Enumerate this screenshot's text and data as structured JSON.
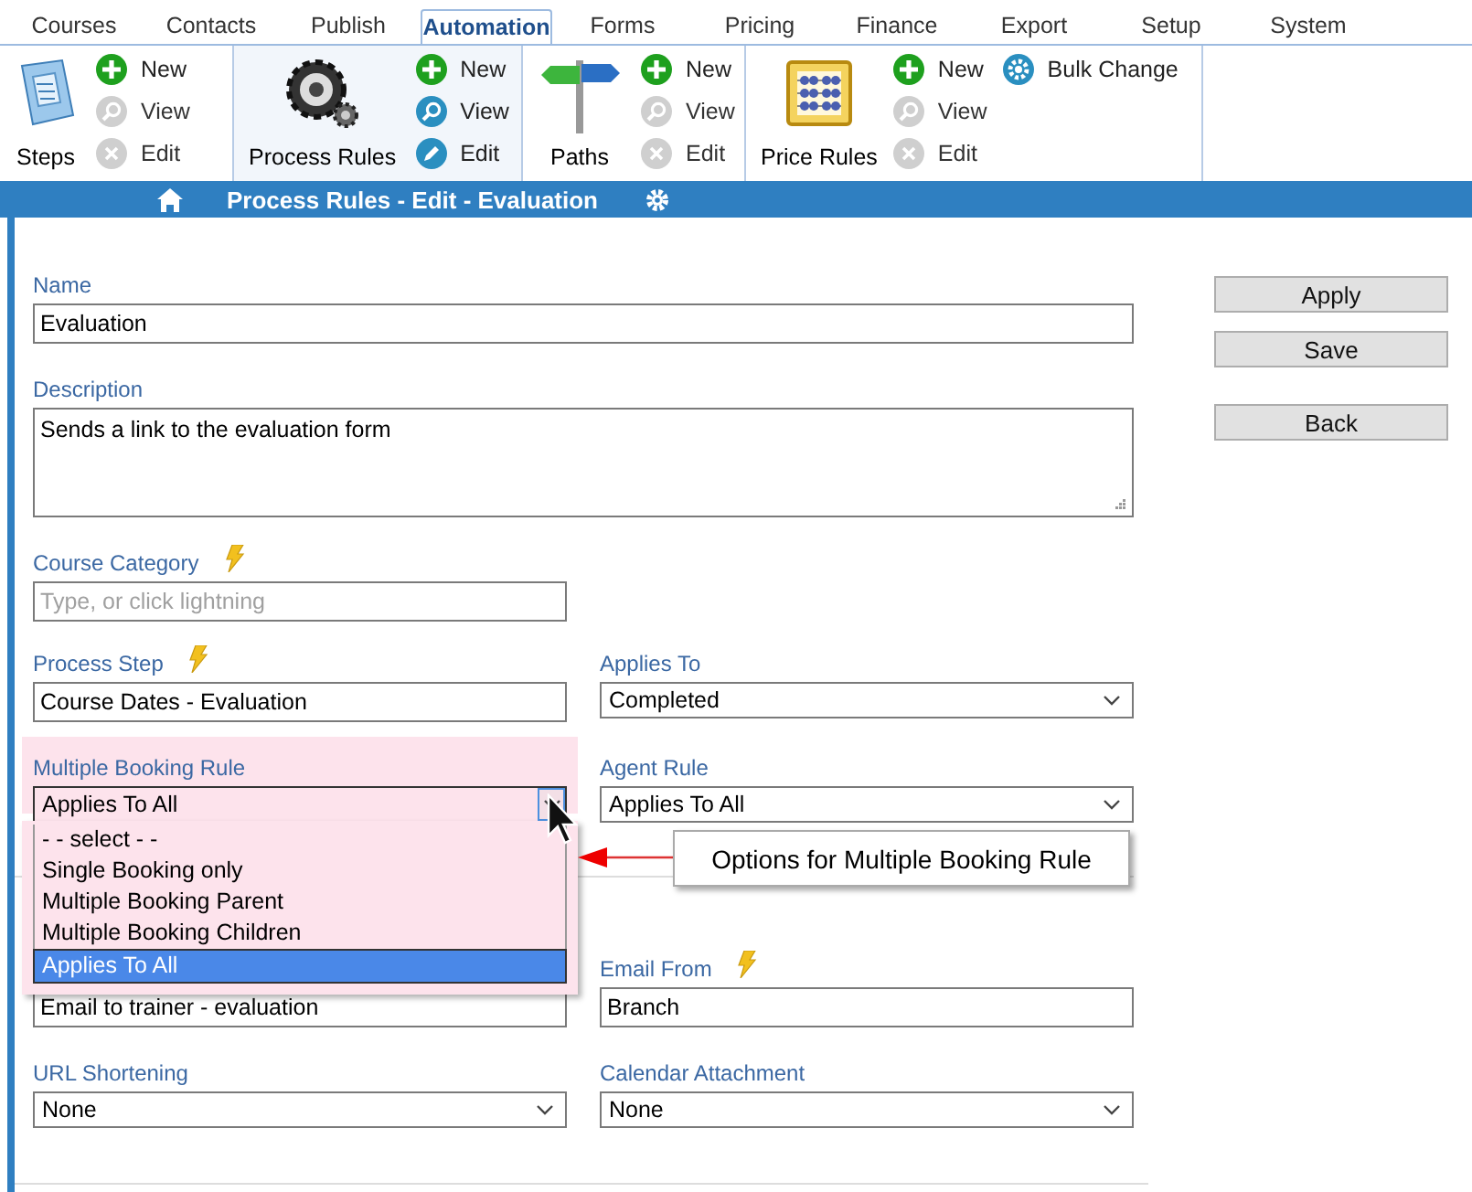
{
  "tabs": [
    {
      "label": "Courses",
      "selected": false
    },
    {
      "label": "Contacts",
      "selected": false
    },
    {
      "label": "Publish",
      "selected": false
    },
    {
      "label": "Automation",
      "selected": true
    },
    {
      "label": "Forms",
      "selected": false
    },
    {
      "label": "Pricing",
      "selected": false
    },
    {
      "label": "Finance",
      "selected": false
    },
    {
      "label": "Export",
      "selected": false
    },
    {
      "label": "Setup",
      "selected": false
    },
    {
      "label": "System",
      "selected": false
    }
  ],
  "ribbon": {
    "groups": [
      {
        "label": "Steps",
        "selected": false,
        "columns": [
          [
            {
              "label": "New",
              "kind": "new",
              "disabled": false
            },
            {
              "label": "View",
              "kind": "view",
              "disabled": true
            },
            {
              "label": "Edit",
              "kind": "edit",
              "disabled": true
            }
          ]
        ]
      },
      {
        "label": "Process Rules",
        "selected": true,
        "columns": [
          [
            {
              "label": "New",
              "kind": "new",
              "disabled": false
            },
            {
              "label": "View",
              "kind": "view",
              "disabled": false
            },
            {
              "label": "Edit",
              "kind": "edit",
              "disabled": false
            }
          ]
        ]
      },
      {
        "label": "Paths",
        "selected": false,
        "columns": [
          [
            {
              "label": "New",
              "kind": "new",
              "disabled": false
            },
            {
              "label": "View",
              "kind": "view",
              "disabled": true
            },
            {
              "label": "Edit",
              "kind": "edit",
              "disabled": true
            }
          ]
        ]
      },
      {
        "label": "Price Rules",
        "selected": false,
        "columns": [
          [
            {
              "label": "New",
              "kind": "new",
              "disabled": false
            },
            {
              "label": "View",
              "kind": "view",
              "disabled": true
            },
            {
              "label": "Edit",
              "kind": "edit",
              "disabled": true
            }
          ],
          [
            {
              "label": "Bulk Change",
              "kind": "bulk",
              "disabled": false
            }
          ]
        ]
      }
    ]
  },
  "title_bar": {
    "title": "Process Rules - Edit - Evaluation"
  },
  "form": {
    "rows": [
      [
        {
          "kind": "text",
          "label": "Name",
          "value": "Evaluation"
        }
      ],
      [
        {
          "kind": "textarea",
          "label": "Description",
          "value": "Sends a link to the evaluation form"
        }
      ],
      [
        {
          "kind": "text",
          "label": "Course Category",
          "placeholder": "Type, or click lightning",
          "lightning": true
        }
      ],
      [
        {
          "kind": "text",
          "label": "Process Step",
          "value": "Course Dates - Evaluation",
          "lightning": true
        },
        {
          "kind": "select",
          "label": "Applies To",
          "value": "Completed"
        }
      ],
      [
        {
          "kind": "select",
          "label": "Multiple Booking Rule",
          "value": "Applies To All",
          "highlighted": true,
          "open": true,
          "options": [
            {
              "label": "- - select - -",
              "selected": false
            },
            {
              "label": "Single Booking only",
              "selected": false
            },
            {
              "label": "Multiple Booking Parent",
              "selected": false
            },
            {
              "label": "Multiple Booking Children",
              "selected": false
            },
            {
              "label": "Applies To All",
              "selected": true
            }
          ]
        },
        {
          "kind": "select",
          "label": "Agent Rule",
          "value": "Applies To All"
        }
      ],
      [
        {
          "kind": "text",
          "value": "Email to trainer - evaluation"
        },
        {
          "kind": "text",
          "label": "Email From",
          "value": "Branch",
          "lightning": true
        }
      ],
      [
        {
          "kind": "select",
          "label": "URL Shortening",
          "value": "None"
        },
        {
          "kind": "select",
          "label": "Calendar Attachment",
          "value": "None"
        }
      ]
    ]
  },
  "callout": {
    "text": "Options for Multiple Booking Rule"
  },
  "buttons": [
    "Apply",
    "Save",
    "Back"
  ]
}
